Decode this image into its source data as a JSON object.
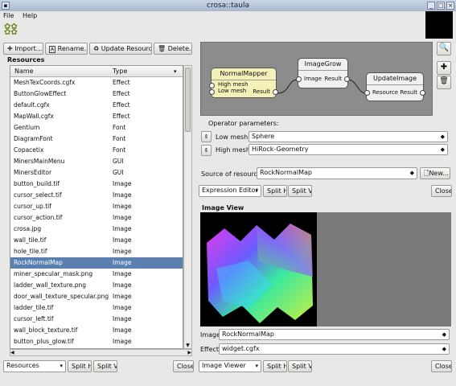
{
  "window": {
    "title": "crosa::taula"
  },
  "menu": [
    "File",
    "Help"
  ],
  "toolbar": {
    "import_label": "Import...",
    "rename_label": "Rename...",
    "update_label": "Update Resource",
    "delete_label": "Delete..."
  },
  "resources": {
    "title": "Resources",
    "columns": [
      "Name",
      "Type"
    ],
    "rows": [
      {
        "name": "MeshTexCoords.cgfx",
        "type": "Effect"
      },
      {
        "name": "ButtonGlowEffect",
        "type": "Effect"
      },
      {
        "name": "default.cgfx",
        "type": "Effect"
      },
      {
        "name": "MapWall.cgfx",
        "type": "Effect"
      },
      {
        "name": "Gentium",
        "type": "Font"
      },
      {
        "name": "DiagramFont",
        "type": "Font"
      },
      {
        "name": "Copacetix",
        "type": "Font"
      },
      {
        "name": "MinersMainMenu",
        "type": "GUI"
      },
      {
        "name": "MinersEditor",
        "type": "GUI"
      },
      {
        "name": "button_build.tif",
        "type": "Image"
      },
      {
        "name": "cursor_select.tif",
        "type": "Image"
      },
      {
        "name": "cursor_up.tif",
        "type": "Image"
      },
      {
        "name": "cursor_action.tif",
        "type": "Image"
      },
      {
        "name": "crosa.jpg",
        "type": "Image"
      },
      {
        "name": "wall_tile.tif",
        "type": "Image"
      },
      {
        "name": "hole_tile.tif",
        "type": "Image"
      },
      {
        "name": "RockNormalMap",
        "type": "Image"
      },
      {
        "name": "miner_specular_mask.png",
        "type": "Image"
      },
      {
        "name": "ladder_wall_texture.png",
        "type": "Image"
      },
      {
        "name": "door_wall_texture_specular.png",
        "type": "Image"
      },
      {
        "name": "ladder_tile.tif",
        "type": "Image"
      },
      {
        "name": "cursor_left.tif",
        "type": "Image"
      },
      {
        "name": "wall_block_texture.tif",
        "type": "Image"
      },
      {
        "name": "button_plus_glow.tif",
        "type": "Image"
      }
    ],
    "selected_index": 16
  },
  "left_bottom": {
    "combo": "Resources",
    "split_h": "Split H",
    "split_v": "Split V",
    "close": "Close"
  },
  "graph": {
    "nodes": [
      {
        "title": "NormalMapper",
        "inputs": [
          "High mesh",
          "Low mesh"
        ],
        "output": "Result"
      },
      {
        "title": "ImageGrow",
        "inputs": [
          "Image"
        ],
        "output": "Result"
      },
      {
        "title": "UpdateImage",
        "inputs": [
          "Resource"
        ],
        "output": "Result"
      }
    ]
  },
  "operator": {
    "label": "Operator parameters:",
    "params": [
      {
        "name": "Low mesh",
        "value": "Sphere"
      },
      {
        "name": "High mesh",
        "value": "HiRock-Geometry"
      }
    ],
    "source_label": "Source of resource",
    "source_value": "RockNormalMap",
    "new_label": "New..."
  },
  "upper_bar": {
    "combo": "Expression Editor",
    "split_h": "Split H",
    "split_v": "Split V",
    "close": "Close"
  },
  "image_view": {
    "title": "Image View",
    "image_label": "Image",
    "image_value": "RockNormalMap",
    "effect_label": "Effect",
    "effect_value": "widget.cgfx"
  },
  "lower_bar": {
    "combo": "Image Viewer",
    "split_h": "Split H",
    "split_v": "Split V",
    "close": "Close"
  }
}
